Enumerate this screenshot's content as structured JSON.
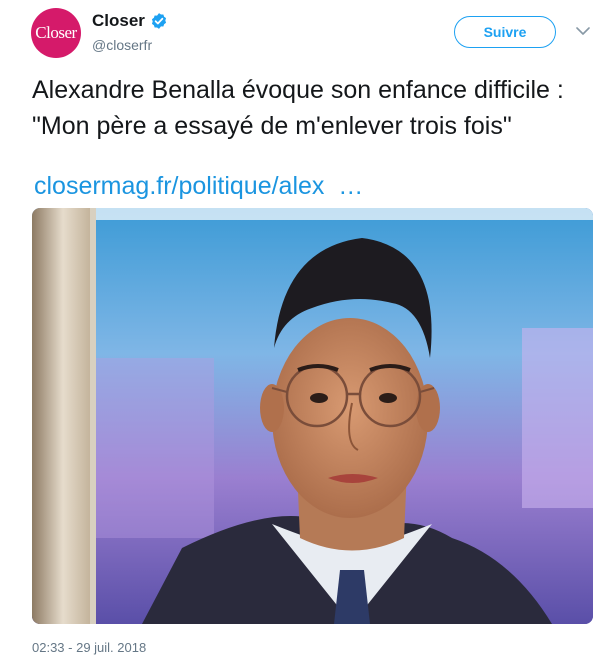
{
  "account": {
    "avatar_text": "Closer",
    "display_name": "Closer",
    "handle": "@closerfr",
    "verified": true,
    "avatar_color": "#d51a6a"
  },
  "actions": {
    "follow_label": "Suivre",
    "menu_icon": "chevron-down-icon"
  },
  "tweet": {
    "text": "Alexandre Benalla évoque son enfance difficile : \"Mon père a essayé de m'enlever trois fois\"",
    "link": "closermag.fr/politique/alex  …",
    "timestamp": "02:33 - 29 juil. 2018"
  },
  "colors": {
    "link": "#1b95e0",
    "accent": "#1da1f2",
    "text": "#14171a",
    "muted": "#657786"
  }
}
